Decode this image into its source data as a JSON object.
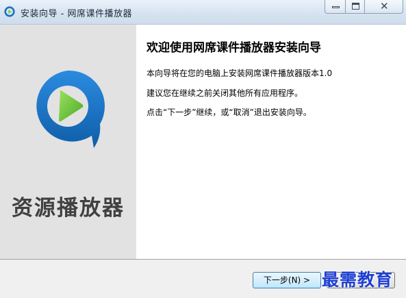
{
  "window": {
    "title": "安装向导 - 网席课件播放器",
    "controls": {
      "minimize_icon": "minimize-icon",
      "maximize_icon": "maximize-icon",
      "close_glyph": "✕"
    }
  },
  "banner": {
    "logo_icon": "play-logo-icon",
    "brand_text": "资源播放器",
    "colors": {
      "ring": "#1b75bb",
      "play": "#7ac943",
      "background": "#e2e2e2"
    }
  },
  "content": {
    "heading": "欢迎使用网席课件播放器安装向导",
    "lines": [
      "本向导将在您的电脑上安装网席课件播放器版本1.0",
      "建议您在继续之前关闭其他所有应用程序。",
      "点击“下一步”继续，或“取消”退出安装向导。"
    ]
  },
  "footer": {
    "next_label": "下一步(N) >",
    "cancel_label": ""
  },
  "watermark": "最需教育"
}
